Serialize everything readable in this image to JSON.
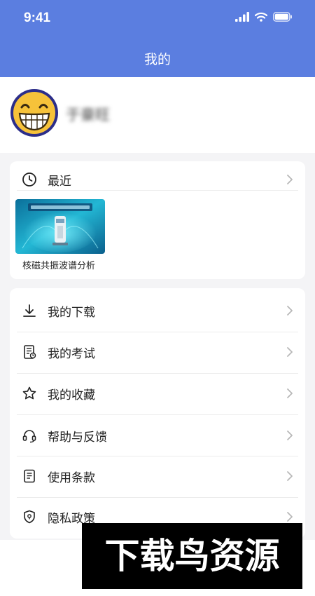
{
  "status_bar": {
    "time": "9:41"
  },
  "header": {
    "title": "我的"
  },
  "profile": {
    "username": "于豪旺"
  },
  "recent": {
    "title": "最近",
    "item_caption": "核磁共振波谱分析"
  },
  "menu": {
    "items": [
      {
        "label": "我的下载",
        "icon": "download-icon"
      },
      {
        "label": "我的考试",
        "icon": "exam-icon"
      },
      {
        "label": "我的收藏",
        "icon": "star-icon"
      },
      {
        "label": "帮助与反馈",
        "icon": "headset-icon"
      },
      {
        "label": "使用条款",
        "icon": "document-icon"
      },
      {
        "label": "隐私政策",
        "icon": "shield-icon"
      }
    ]
  },
  "watermark": {
    "text": "下载鸟资源"
  },
  "colors": {
    "header": "#5b7ee0",
    "background": "#f4f4f6",
    "card": "#ffffff",
    "chevron": "#b8b8b8",
    "watermark_bg": "#000000"
  }
}
